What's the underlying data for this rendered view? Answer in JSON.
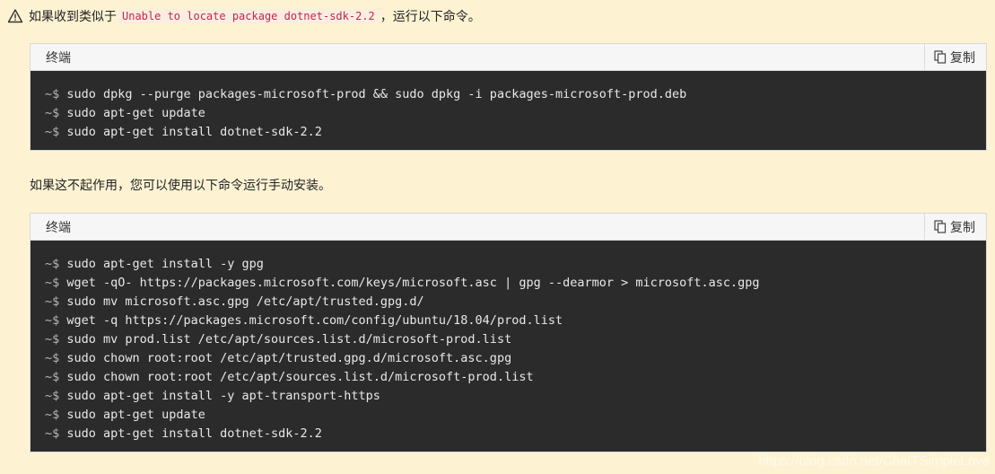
{
  "warning": {
    "icon": "warning-triangle-icon",
    "prefix": "如果收到类似于",
    "code": "Unable to locate package dotnet-sdk-2.2",
    "suffix": "，运行以下命令。"
  },
  "block1": {
    "title": "终端",
    "copy_label": "复制",
    "prompt": "~$",
    "lines": [
      "sudo dpkg --purge packages-microsoft-prod && sudo dpkg -i packages-microsoft-prod.deb",
      "sudo apt-get update",
      "sudo apt-get install dotnet-sdk-2.2"
    ]
  },
  "paragraph": "如果这不起作用，您可以使用以下命令运行手动安装。",
  "block2": {
    "title": "终端",
    "copy_label": "复制",
    "prompt": "~$",
    "lines": [
      "sudo apt-get install -y gpg",
      "wget -qO- https://packages.microsoft.com/keys/microsoft.asc | gpg --dearmor > microsoft.asc.gpg",
      "sudo mv microsoft.asc.gpg /etc/apt/trusted.gpg.d/",
      "wget -q https://packages.microsoft.com/config/ubuntu/18.04/prod.list",
      "sudo mv prod.list /etc/apt/sources.list.d/microsoft-prod.list",
      "sudo chown root:root /etc/apt/trusted.gpg.d/microsoft.asc.gpg",
      "sudo chown root:root /etc/apt/sources.list.d/microsoft-prod.list",
      "sudo apt-get install -y apt-transport-https",
      "sudo apt-get update",
      "sudo apt-get install dotnet-sdk-2.2"
    ]
  },
  "watermark": "https://blog.csdn.net/ChaITSimpleLove",
  "colors": {
    "page_bg": "#fdf3d3",
    "code_bg": "#2b2b2b",
    "inline_code": "#c7254e"
  }
}
